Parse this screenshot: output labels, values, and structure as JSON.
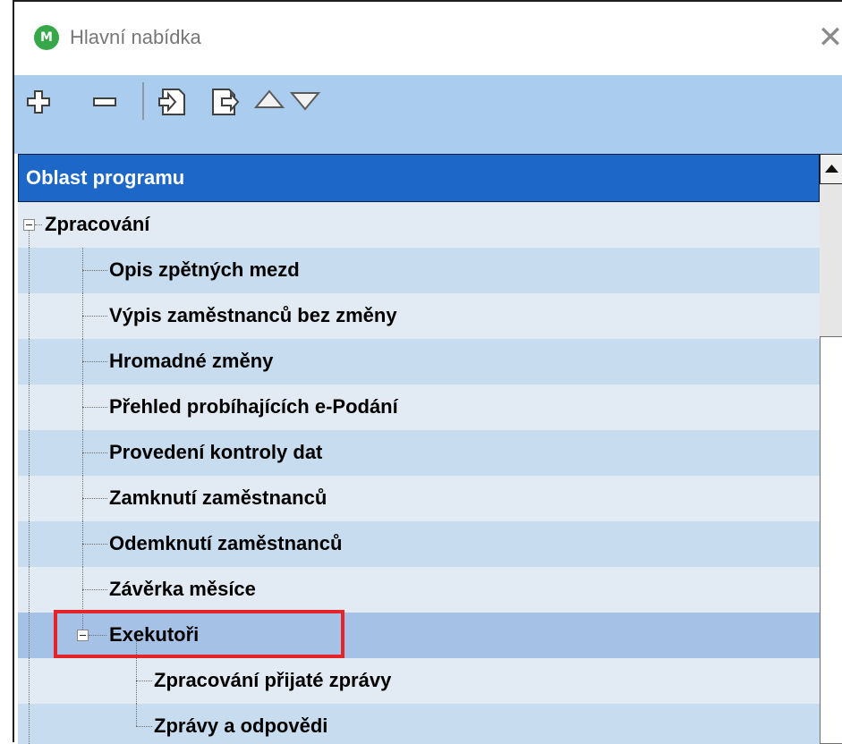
{
  "window": {
    "title": "Hlavní nabídka",
    "app_icon_letter": "M",
    "close_glyph": "✕"
  },
  "toolbar": {
    "buttons": [
      {
        "name": "expand-all-icon"
      },
      {
        "name": "collapse-all-icon"
      },
      {
        "name": "import-icon"
      },
      {
        "name": "export-icon"
      },
      {
        "name": "move-up-icon"
      },
      {
        "name": "move-down-icon"
      }
    ]
  },
  "tree": {
    "header": "Oblast programu",
    "items": [
      {
        "label": "Zpracování"
      },
      {
        "label": "Opis zpětných mezd"
      },
      {
        "label": "Výpis zaměstnanců bez změny"
      },
      {
        "label": "Hromadné změny"
      },
      {
        "label": "Přehled probíhajících e-Podání"
      },
      {
        "label": "Provedení kontroly dat"
      },
      {
        "label": "Zamknutí zaměstnanců"
      },
      {
        "label": "Odemknutí zaměstnanců"
      },
      {
        "label": "Závěrka měsíce"
      },
      {
        "label": "Exekutoři"
      },
      {
        "label": "Zpracování přijaté zprávy"
      },
      {
        "label": "Zprávy a odpovědi"
      }
    ]
  },
  "colors": {
    "header": "#1d67c9",
    "toolbar": "#a9ccef",
    "row_even": "#c7dcef",
    "row_odd": "#e2ebf4",
    "selected": "#a5c2e6",
    "highlight": "#e3252b"
  }
}
